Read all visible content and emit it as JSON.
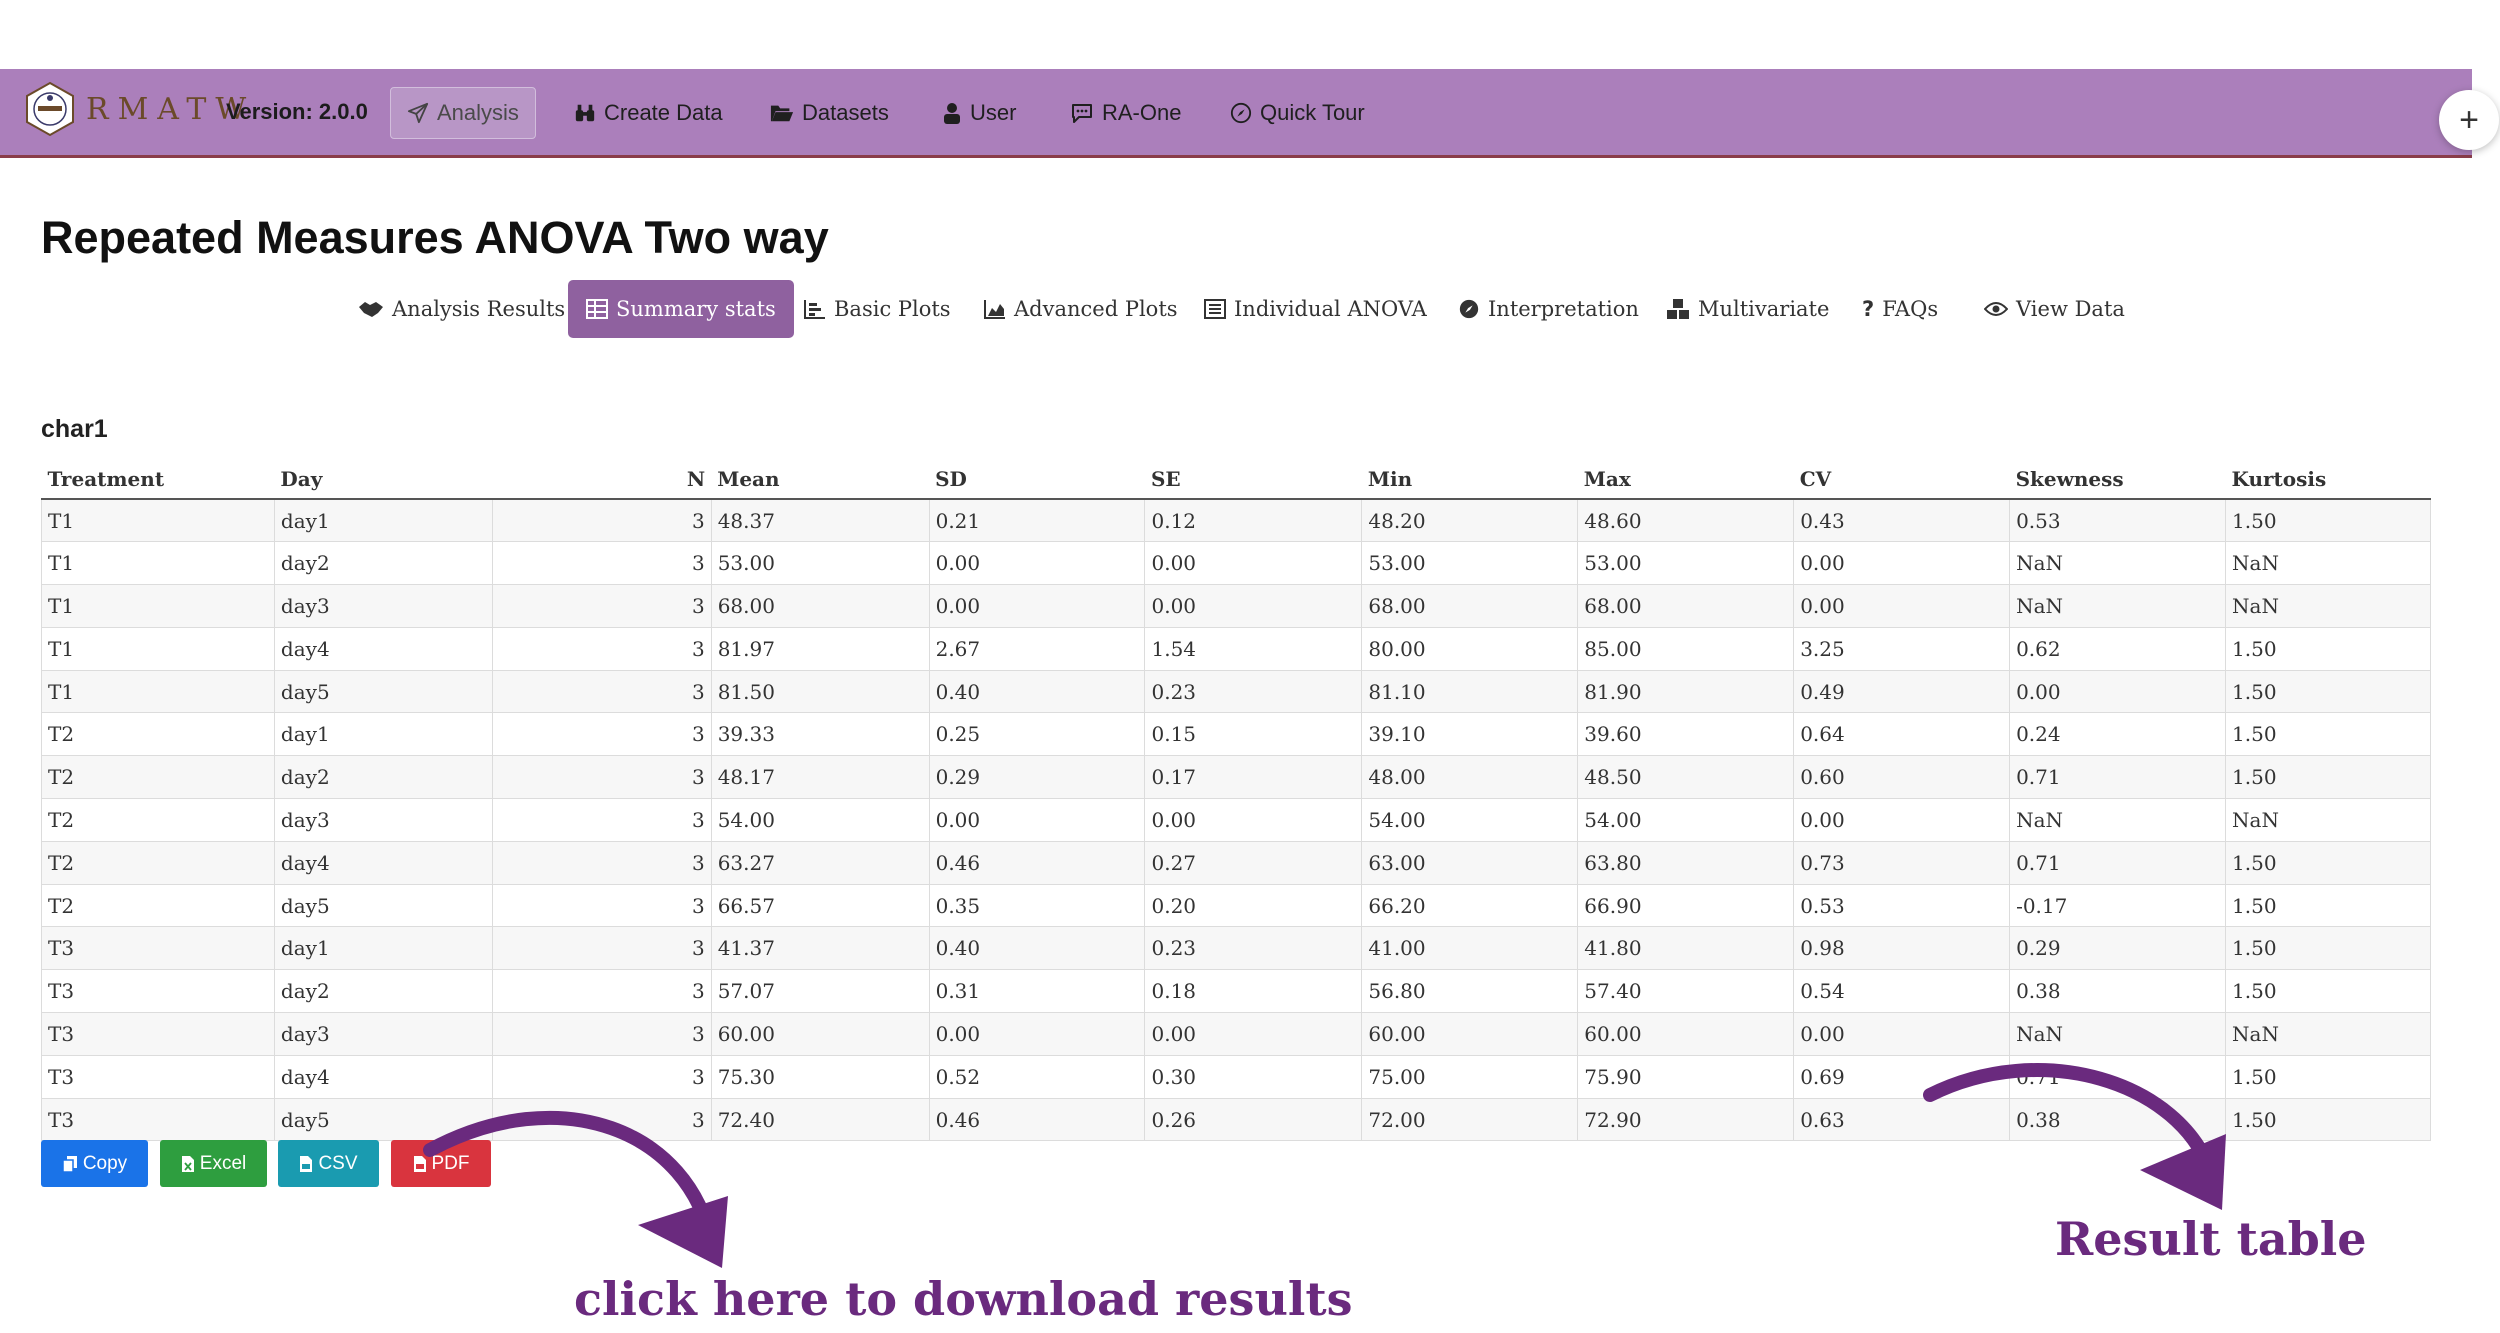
{
  "navbar": {
    "logo_text": "RMATW",
    "version": "Version: 2.0.0",
    "items": [
      {
        "label": "Analysis"
      },
      {
        "label": "Create Data"
      },
      {
        "label": "Datasets"
      },
      {
        "label": "User"
      },
      {
        "label": "RA-One"
      },
      {
        "label": "Quick Tour"
      }
    ],
    "plus": "+"
  },
  "page": {
    "title": "Repeated Measures ANOVA Two way"
  },
  "tabs": [
    {
      "label": "Analysis Results"
    },
    {
      "label": "Summary stats"
    },
    {
      "label": "Basic Plots"
    },
    {
      "label": "Advanced Plots"
    },
    {
      "label": "Individual ANOVA"
    },
    {
      "label": "Interpretation"
    },
    {
      "label": "Multivariate"
    },
    {
      "label": "FAQs"
    },
    {
      "label": "View Data"
    }
  ],
  "table": {
    "title": "char1",
    "headers": [
      "Treatment",
      "Day",
      "N",
      "Mean",
      "SD",
      "SE",
      "Min",
      "Max",
      "CV",
      "Skewness",
      "Kurtosis"
    ],
    "rows": [
      [
        "T1",
        "day1",
        "3",
        "48.37",
        "0.21",
        "0.12",
        "48.20",
        "48.60",
        "0.43",
        "0.53",
        "1.50"
      ],
      [
        "T1",
        "day2",
        "3",
        "53.00",
        "0.00",
        "0.00",
        "53.00",
        "53.00",
        "0.00",
        "NaN",
        "NaN"
      ],
      [
        "T1",
        "day3",
        "3",
        "68.00",
        "0.00",
        "0.00",
        "68.00",
        "68.00",
        "0.00",
        "NaN",
        "NaN"
      ],
      [
        "T1",
        "day4",
        "3",
        "81.97",
        "2.67",
        "1.54",
        "80.00",
        "85.00",
        "3.25",
        "0.62",
        "1.50"
      ],
      [
        "T1",
        "day5",
        "3",
        "81.50",
        "0.40",
        "0.23",
        "81.10",
        "81.90",
        "0.49",
        "0.00",
        "1.50"
      ],
      [
        "T2",
        "day1",
        "3",
        "39.33",
        "0.25",
        "0.15",
        "39.10",
        "39.60",
        "0.64",
        "0.24",
        "1.50"
      ],
      [
        "T2",
        "day2",
        "3",
        "48.17",
        "0.29",
        "0.17",
        "48.00",
        "48.50",
        "0.60",
        "0.71",
        "1.50"
      ],
      [
        "T2",
        "day3",
        "3",
        "54.00",
        "0.00",
        "0.00",
        "54.00",
        "54.00",
        "0.00",
        "NaN",
        "NaN"
      ],
      [
        "T2",
        "day4",
        "3",
        "63.27",
        "0.46",
        "0.27",
        "63.00",
        "63.80",
        "0.73",
        "0.71",
        "1.50"
      ],
      [
        "T2",
        "day5",
        "3",
        "66.57",
        "0.35",
        "0.20",
        "66.20",
        "66.90",
        "0.53",
        "-0.17",
        "1.50"
      ],
      [
        "T3",
        "day1",
        "3",
        "41.37",
        "0.40",
        "0.23",
        "41.00",
        "41.80",
        "0.98",
        "0.29",
        "1.50"
      ],
      [
        "T3",
        "day2",
        "3",
        "57.07",
        "0.31",
        "0.18",
        "56.80",
        "57.40",
        "0.54",
        "0.38",
        "1.50"
      ],
      [
        "T3",
        "day3",
        "3",
        "60.00",
        "0.00",
        "0.00",
        "60.00",
        "60.00",
        "0.00",
        "NaN",
        "NaN"
      ],
      [
        "T3",
        "day4",
        "3",
        "75.30",
        "0.52",
        "0.30",
        "75.00",
        "75.90",
        "0.69",
        "0.71",
        "1.50"
      ],
      [
        "T3",
        "day5",
        "3",
        "72.40",
        "0.46",
        "0.26",
        "72.00",
        "72.90",
        "0.63",
        "0.38",
        "1.50"
      ]
    ]
  },
  "export_buttons": {
    "copy": "Copy",
    "excel": "Excel",
    "csv": "CSV",
    "pdf": "PDF"
  },
  "annotations": {
    "download": "click here to download results",
    "result_table": "Result table"
  },
  "colors": {
    "navbar": "#ab7fbb",
    "active_tab": "#8f619f",
    "copy": "#1a73e8",
    "excel": "#2e9e3f",
    "csv": "#1a9bb0",
    "pdf": "#d9343e",
    "annotation": "#6a2a7e"
  }
}
